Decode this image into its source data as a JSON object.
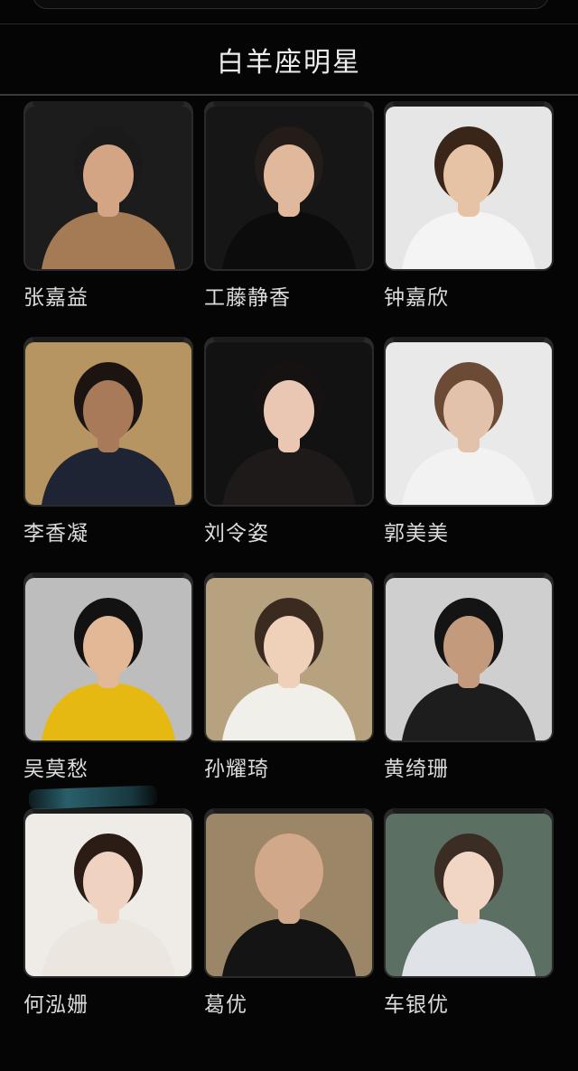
{
  "header": {
    "title": "白羊座明星"
  },
  "celebrities": [
    {
      "name": "张嘉益",
      "bg": "#1c1c1c",
      "skin": "#d4a585",
      "hair": "#1a1a1a",
      "outfit": "#a57b55"
    },
    {
      "name": "工藤静香",
      "bg": "#161616",
      "skin": "#e0b99c",
      "hair": "#241c18",
      "outfit": "#0c0c0c"
    },
    {
      "name": "钟嘉欣",
      "bg": "#e6e6e6",
      "skin": "#e7c3a5",
      "hair": "#3a2618",
      "outfit": "#f4f4f4"
    },
    {
      "name": "李香凝",
      "bg": "#b79562",
      "skin": "#a97a5a",
      "hair": "#1b1411",
      "outfit": "#1e2433"
    },
    {
      "name": "刘令姿",
      "bg": "#121212",
      "skin": "#e9c7b3",
      "hair": "#171212",
      "outfit": "#1e1a1a"
    },
    {
      "name": "郭美美",
      "bg": "#e9e9e9",
      "skin": "#e2c2aa",
      "hair": "#6b4a36",
      "outfit": "#f2f2f2"
    },
    {
      "name": "吴莫愁",
      "bg": "#bdbdbd",
      "skin": "#e3b896",
      "hair": "#121212",
      "outfit": "#e5b912"
    },
    {
      "name": "孙耀琦",
      "bg": "#b7a27f",
      "skin": "#efd1ba",
      "hair": "#3b2a20",
      "outfit": "#f1efe9"
    },
    {
      "name": "黄绮珊",
      "bg": "#cfcfcf",
      "skin": "#c49a7c",
      "hair": "#141414",
      "outfit": "#1d1d1d"
    },
    {
      "name": "何泓姗",
      "bg": "#efebe7",
      "skin": "#f0d2c0",
      "hair": "#2b1c16",
      "outfit": "#ece6e0"
    },
    {
      "name": "葛优",
      "bg": "#9b8767",
      "skin": "#d1a98a",
      "hair": "#d1a98a",
      "outfit": "#141414"
    },
    {
      "name": "车银优",
      "bg": "#5b6f63",
      "skin": "#f1d6c4",
      "hair": "#3b2c24",
      "outfit": "#dfe2e6"
    }
  ]
}
